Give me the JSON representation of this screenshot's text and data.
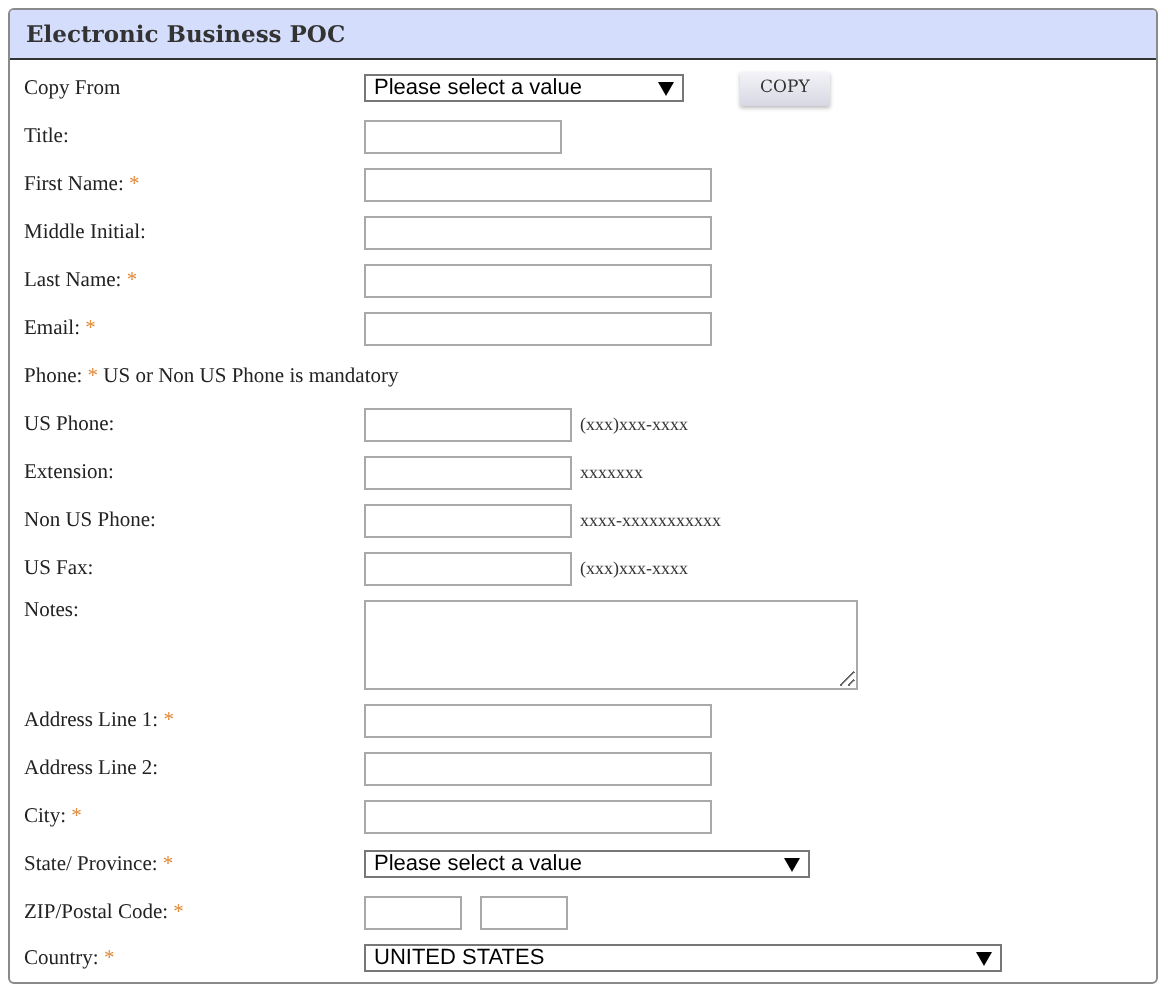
{
  "panel": {
    "title": "Electronic Business POC"
  },
  "rows": [
    {
      "kind": "copy-select",
      "label": "Copy From",
      "value": "Please select a value",
      "button": "COPY"
    },
    {
      "kind": "text-short",
      "label": "Title:"
    },
    {
      "kind": "text",
      "label": "First Name:",
      "required_mark": "*"
    },
    {
      "kind": "text",
      "label": "Middle Initial:"
    },
    {
      "kind": "text",
      "label": "Last Name:",
      "required_mark": "*"
    },
    {
      "kind": "text",
      "label": "Email:",
      "required_mark": "*"
    },
    {
      "kind": "note",
      "label": "Phone:",
      "required_mark": "*",
      "note": "US or Non US Phone is mandatory"
    },
    {
      "kind": "phone",
      "label": "US Phone:",
      "hint": "(xxx)xxx-xxxx"
    },
    {
      "kind": "phone",
      "label": "Extension:",
      "hint": "xxxxxxx"
    },
    {
      "kind": "phone",
      "label": "Non US Phone:",
      "hint": "xxxx-xxxxxxxxxxx"
    },
    {
      "kind": "phone",
      "label": "US Fax:",
      "hint": "(xxx)xxx-xxxx"
    },
    {
      "kind": "textarea",
      "label": "Notes:"
    },
    {
      "kind": "text",
      "label": "Address Line 1:",
      "required_mark": "*"
    },
    {
      "kind": "text",
      "label": "Address Line 2:"
    },
    {
      "kind": "text",
      "label": "City:",
      "required_mark": "*"
    },
    {
      "kind": "select",
      "label": "State/ Province:",
      "required_mark": "*",
      "value": "Please select a value"
    },
    {
      "kind": "zip",
      "label": "ZIP/Postal Code:",
      "required_mark": "*"
    },
    {
      "kind": "wide-select",
      "label": "Country:",
      "required_mark": "*",
      "value": "UNITED STATES"
    }
  ]
}
